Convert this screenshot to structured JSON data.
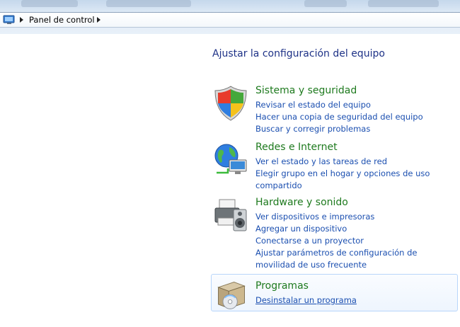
{
  "breadcrumb": {
    "root": "Panel de control"
  },
  "heading": "Ajustar la configuración del equipo",
  "categories": [
    {
      "title": "Sistema y seguridad",
      "icon": "shield-icon",
      "links": [
        "Revisar el estado del equipo",
        "Hacer una copia de seguridad del equipo",
        "Buscar y corregir problemas"
      ]
    },
    {
      "title": "Redes e Internet",
      "icon": "network-globe-icon",
      "links": [
        "Ver el estado y las tareas de red",
        "Elegir grupo en el hogar y opciones de uso compartido"
      ]
    },
    {
      "title": "Hardware y sonido",
      "icon": "printer-speaker-icon",
      "links": [
        "Ver dispositivos e impresoras",
        "Agregar un dispositivo",
        "Conectarse a un proyector",
        "Ajustar parámetros de configuración de movilidad de uso frecuente"
      ]
    },
    {
      "title": "Programas",
      "icon": "programs-box-icon",
      "links": [
        "Desinstalar un programa"
      ]
    }
  ],
  "colors": {
    "heading": "#1e3287",
    "category_title": "#1e7a1e",
    "link": "#1b4fb0",
    "selection_border": "#b8d6fb"
  }
}
